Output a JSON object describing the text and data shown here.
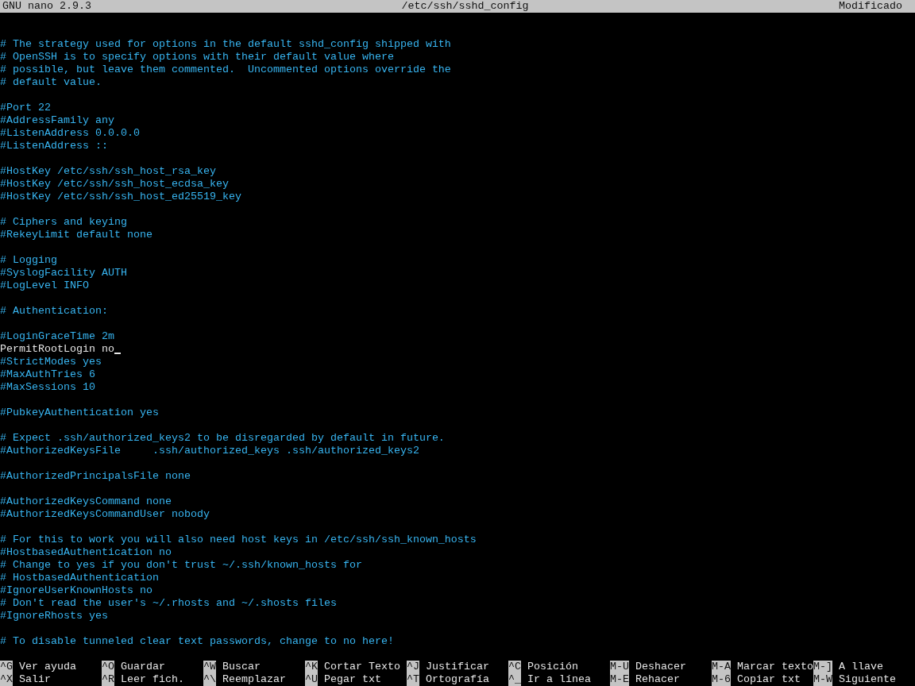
{
  "title_bar": {
    "app": "GNU nano 2.9.3",
    "file": "/etc/ssh/sshd_config",
    "status": "Modificado"
  },
  "lines": [
    {
      "kind": "blank"
    },
    {
      "kind": "blank"
    },
    {
      "kind": "comment",
      "text": "# The strategy used for options in the default sshd_config shipped with",
      "cursor": false
    },
    {
      "kind": "comment",
      "text": "# OpenSSH is to specify options with their default value where",
      "cursor": false
    },
    {
      "kind": "comment",
      "text": "# possible, but leave them commented.  Uncommented options override the",
      "cursor": false
    },
    {
      "kind": "comment",
      "text": "# default value.",
      "cursor": false
    },
    {
      "kind": "blank"
    },
    {
      "kind": "comment",
      "text": "#Port 22",
      "cursor": false
    },
    {
      "kind": "comment",
      "text": "#AddressFamily any",
      "cursor": false
    },
    {
      "kind": "comment",
      "text": "#ListenAddress 0.0.0.0",
      "cursor": false
    },
    {
      "kind": "comment",
      "text": "#ListenAddress ::",
      "cursor": false
    },
    {
      "kind": "blank"
    },
    {
      "kind": "comment",
      "text": "#HostKey /etc/ssh/ssh_host_rsa_key",
      "cursor": false
    },
    {
      "kind": "comment",
      "text": "#HostKey /etc/ssh/ssh_host_ecdsa_key",
      "cursor": false
    },
    {
      "kind": "comment",
      "text": "#HostKey /etc/ssh/ssh_host_ed25519_key",
      "cursor": false
    },
    {
      "kind": "blank"
    },
    {
      "kind": "comment",
      "text": "# Ciphers and keying",
      "cursor": false
    },
    {
      "kind": "comment",
      "text": "#RekeyLimit default none",
      "cursor": false
    },
    {
      "kind": "blank"
    },
    {
      "kind": "comment",
      "text": "# Logging",
      "cursor": false
    },
    {
      "kind": "comment",
      "text": "#SyslogFacility AUTH",
      "cursor": false
    },
    {
      "kind": "comment",
      "text": "#LogLevel INFO",
      "cursor": false
    },
    {
      "kind": "blank"
    },
    {
      "kind": "comment",
      "text": "# Authentication:",
      "cursor": false
    },
    {
      "kind": "blank"
    },
    {
      "kind": "comment",
      "text": "#LoginGraceTime 2m",
      "cursor": false
    },
    {
      "kind": "setting",
      "text": "PermitRootLogin no",
      "cursor": true
    },
    {
      "kind": "comment",
      "text": "#StrictModes yes",
      "cursor": false
    },
    {
      "kind": "comment",
      "text": "#MaxAuthTries 6",
      "cursor": false
    },
    {
      "kind": "comment",
      "text": "#MaxSessions 10",
      "cursor": false
    },
    {
      "kind": "blank"
    },
    {
      "kind": "comment",
      "text": "#PubkeyAuthentication yes",
      "cursor": false
    },
    {
      "kind": "blank"
    },
    {
      "kind": "comment",
      "text": "# Expect .ssh/authorized_keys2 to be disregarded by default in future.",
      "cursor": false
    },
    {
      "kind": "comment",
      "text": "#AuthorizedKeysFile     .ssh/authorized_keys .ssh/authorized_keys2",
      "cursor": false
    },
    {
      "kind": "blank"
    },
    {
      "kind": "comment",
      "text": "#AuthorizedPrincipalsFile none",
      "cursor": false
    },
    {
      "kind": "blank"
    },
    {
      "kind": "comment",
      "text": "#AuthorizedKeysCommand none",
      "cursor": false
    },
    {
      "kind": "comment",
      "text": "#AuthorizedKeysCommandUser nobody",
      "cursor": false
    },
    {
      "kind": "blank"
    },
    {
      "kind": "comment",
      "text": "# For this to work you will also need host keys in /etc/ssh/ssh_known_hosts",
      "cursor": false
    },
    {
      "kind": "comment",
      "text": "#HostbasedAuthentication no",
      "cursor": false
    },
    {
      "kind": "comment",
      "text": "# Change to yes if you don't trust ~/.ssh/known_hosts for",
      "cursor": false
    },
    {
      "kind": "comment",
      "text": "# HostbasedAuthentication",
      "cursor": false
    },
    {
      "kind": "comment",
      "text": "#IgnoreUserKnownHosts no",
      "cursor": false
    },
    {
      "kind": "comment",
      "text": "# Don't read the user's ~/.rhosts and ~/.shosts files",
      "cursor": false
    },
    {
      "kind": "comment",
      "text": "#IgnoreRhosts yes",
      "cursor": false
    },
    {
      "kind": "blank"
    },
    {
      "kind": "comment",
      "text": "# To disable tunneled clear text passwords, change to no here!",
      "cursor": false
    },
    {
      "kind": "blank"
    }
  ],
  "shortcuts": [
    [
      {
        "key": "^G",
        "label": "Ver ayuda"
      },
      {
        "key": "^O",
        "label": "Guardar"
      },
      {
        "key": "^W",
        "label": "Buscar"
      },
      {
        "key": "^K",
        "label": "Cortar Texto"
      },
      {
        "key": "^J",
        "label": "Justificar"
      },
      {
        "key": "^C",
        "label": "Posición"
      },
      {
        "key": "M-U",
        "label": "Deshacer"
      },
      {
        "key": "M-A",
        "label": "Marcar texto"
      },
      {
        "key": "M-]",
        "label": "A llave"
      }
    ],
    [
      {
        "key": "^X",
        "label": "Salir"
      },
      {
        "key": "^R",
        "label": "Leer fich."
      },
      {
        "key": "^\\",
        "label": "Reemplazar"
      },
      {
        "key": "^U",
        "label": "Pegar txt"
      },
      {
        "key": "^T",
        "label": "Ortografía"
      },
      {
        "key": "^_",
        "label": "Ir a línea"
      },
      {
        "key": "M-E",
        "label": "Rehacer"
      },
      {
        "key": "M-6",
        "label": "Copiar txt"
      },
      {
        "key": "M-W",
        "label": "Siguiente"
      }
    ]
  ]
}
